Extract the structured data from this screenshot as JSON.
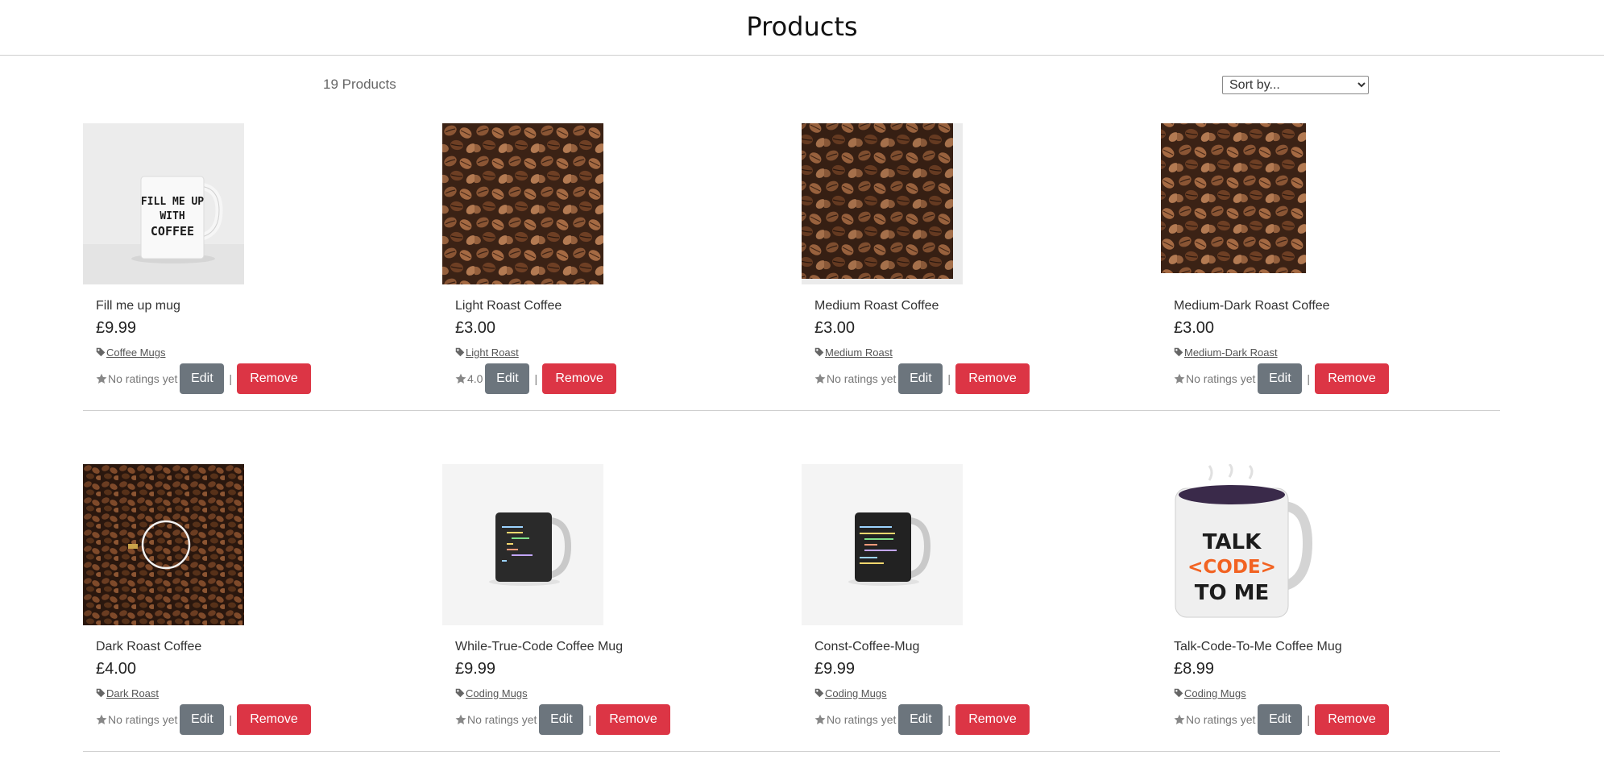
{
  "header": {
    "title": "Products"
  },
  "toolbar": {
    "count_text": "19 Products",
    "sort_selected": "Sort by..."
  },
  "products": [
    {
      "name": "Fill me up mug",
      "price": "£9.99",
      "category": "Coffee Mugs",
      "rating": "No ratings yet",
      "image": "mug-fill-me-up"
    },
    {
      "name": "Light Roast Coffee",
      "price": "£3.00",
      "category": "Light Roast",
      "rating": "4.0",
      "image": "coffee-beans"
    },
    {
      "name": "Medium Roast Coffee",
      "price": "£3.00",
      "category": "Medium Roast",
      "rating": "No ratings yet",
      "image": "coffee-beans"
    },
    {
      "name": "Medium-Dark Roast Coffee",
      "price": "£3.00",
      "category": "Medium-Dark Roast",
      "rating": "No ratings yet",
      "image": "coffee-beans"
    },
    {
      "name": "Dark Roast Coffee",
      "price": "£4.00",
      "category": "Dark Roast",
      "rating": "No ratings yet",
      "image": "dark-beans-cup"
    },
    {
      "name": "While-True-Code Coffee Mug",
      "price": "£9.99",
      "category": "Coding Mugs",
      "rating": "No ratings yet",
      "image": "code-mug"
    },
    {
      "name": "Const-Coffee-Mug",
      "price": "£9.99",
      "category": "Coding Mugs",
      "rating": "No ratings yet",
      "image": "code-mug"
    },
    {
      "name": "Talk-Code-To-Me Coffee Mug",
      "price": "£8.99",
      "category": "Coding Mugs",
      "rating": "No ratings yet",
      "image": "talk-code-mug"
    }
  ],
  "mug_print": {
    "line1": "FILL ME UP",
    "line2": "WITH",
    "line3": "COFFEE"
  },
  "talk_mug_print": {
    "line1": "TALK",
    "line2": "<CODE>",
    "line3": "TO ME"
  },
  "actions": {
    "edit_label": "Edit",
    "remove_label": "Remove",
    "separator": "|"
  },
  "colors": {
    "edit": "#6c757d",
    "remove": "#dc3545",
    "divider": "#cfcfcf"
  },
  "icons": {
    "category": "tag-icon",
    "rating": "star-icon"
  }
}
